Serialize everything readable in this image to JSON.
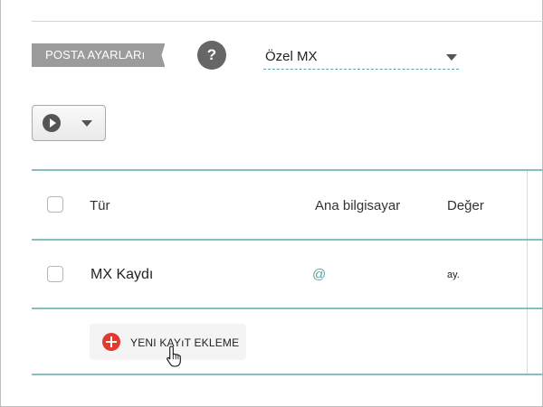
{
  "section": {
    "tag": "POSTA AYARLARı"
  },
  "help": {
    "label": "?"
  },
  "mx_select": {
    "value": "Özel MX"
  },
  "table": {
    "headers": {
      "type": "Tür",
      "host": "Ana bilgisayar",
      "value": "Değer"
    },
    "rows": [
      {
        "type": "MX Kaydı",
        "host": "@",
        "value": "ay."
      }
    ]
  },
  "add_record": {
    "label": "YENI KAYıT EKLEME"
  },
  "colors": {
    "accent": "#87bfbc",
    "add_icon": "#e23a2e",
    "tag_bg": "#9b9b9b",
    "help_bg": "#666666"
  },
  "icons": [
    "help-icon",
    "play-icon",
    "chevron-down-icon",
    "add-icon",
    "hand-cursor-icon"
  ]
}
